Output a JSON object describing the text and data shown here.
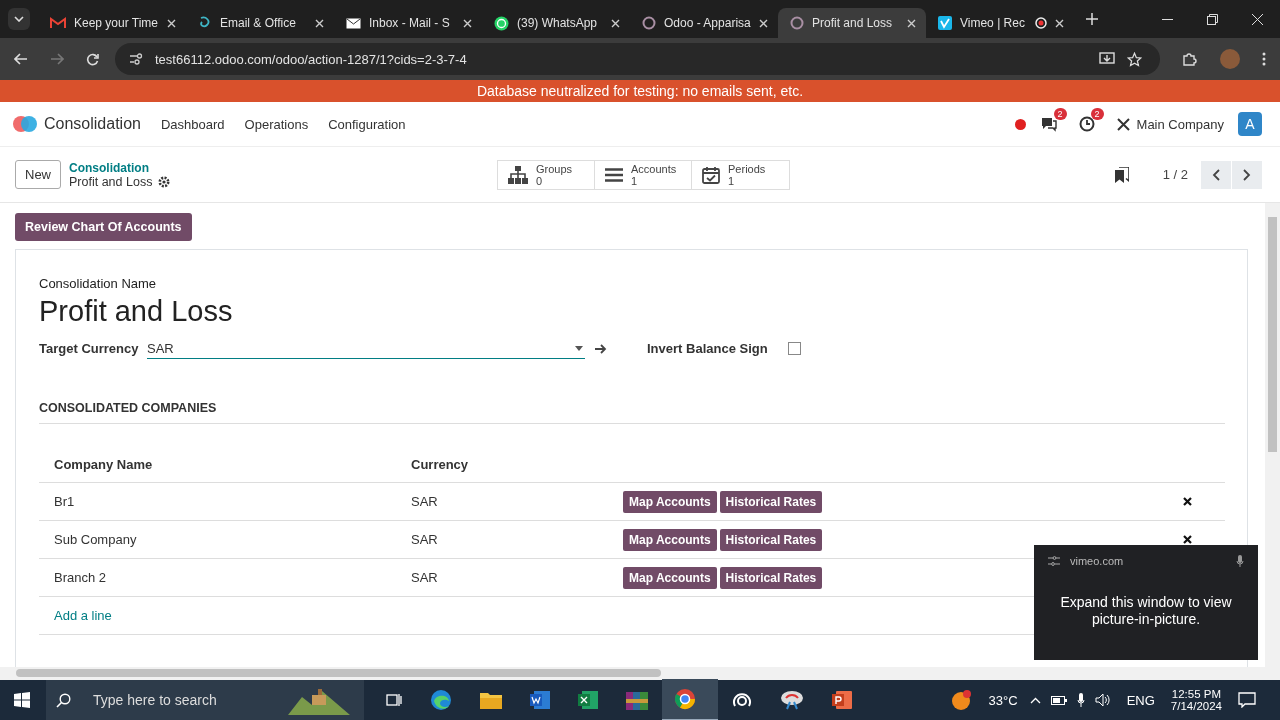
{
  "browser": {
    "tabs": [
      {
        "kind": "gmail",
        "title": "Keep your Time",
        "selected": false
      },
      {
        "kind": "copilot",
        "title": "Email & Office",
        "selected": false
      },
      {
        "kind": "mail",
        "title": "Inbox - Mail - S",
        "selected": false
      },
      {
        "kind": "whatsapp",
        "title": "(39) WhatsApp",
        "selected": false
      },
      {
        "kind": "odoo",
        "title": "Odoo - Apparisa",
        "selected": false
      },
      {
        "kind": "odoo",
        "title": "Profit and Loss",
        "selected": true
      },
      {
        "kind": "vimeo",
        "title": "Vimeo | Rec",
        "selected": false,
        "recording": true
      }
    ],
    "url": "test66112.odoo.com/odoo/action-1287/1?cids=2-3-7-4"
  },
  "banner": "Database neutralized for testing: no emails sent, etc.",
  "navbar": {
    "app_name": "Consolidation",
    "menu": [
      "Dashboard",
      "Operations",
      "Configuration"
    ],
    "messages_count": "2",
    "activities_count": "2",
    "company": "Main Company",
    "avatar": "A"
  },
  "control_panel": {
    "new_button": "New",
    "breadcrumb_parent": "Consolidation",
    "breadcrumb_current": "Profit and Loss",
    "smart_buttons": [
      {
        "kind": "groups",
        "label": "Groups",
        "value": "0"
      },
      {
        "kind": "accounts",
        "label": "Accounts",
        "value": "1"
      },
      {
        "kind": "periods",
        "label": "Periods",
        "value": "1"
      }
    ],
    "pager": "1 / 2"
  },
  "review_button": "Review Chart Of Accounts",
  "form": {
    "name_label": "Consolidation Name",
    "name": "Profit and Loss",
    "currency_label": "Target Currency",
    "currency": "SAR",
    "invert_label": "Invert Balance Sign",
    "invert_checked": false,
    "section_title": "CONSOLIDATED COMPANIES",
    "columns": [
      "Company Name",
      "Currency"
    ],
    "rows": [
      {
        "company": "Br1",
        "currency": "SAR",
        "actions": [
          "Map Accounts",
          "Historical Rates"
        ]
      },
      {
        "company": "Sub Company",
        "currency": "SAR",
        "actions": [
          "Map Accounts",
          "Historical Rates"
        ]
      },
      {
        "company": "Branch 2",
        "currency": "SAR",
        "actions": [
          "Map Accounts",
          "Historical Rates"
        ]
      }
    ],
    "add_line": "Add a line"
  },
  "pip": {
    "host": "vimeo.com",
    "message": "Expand this window to view picture-in-picture."
  },
  "taskbar": {
    "search_placeholder": "Type here to search",
    "temperature": "33°C",
    "language": "ENG",
    "time": "12:55 PM",
    "date": "7/14/2024"
  }
}
